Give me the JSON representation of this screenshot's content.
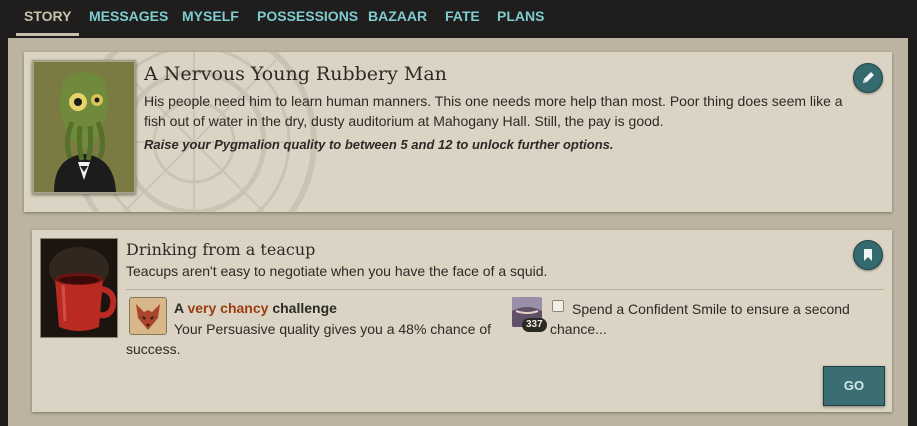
{
  "nav": {
    "tabs": [
      {
        "label": "STORY"
      },
      {
        "label": "MESSAGES"
      },
      {
        "label": "MYSELF"
      },
      {
        "label": "POSSESSIONS"
      },
      {
        "label": "BAZAAR"
      },
      {
        "label": "FATE"
      },
      {
        "label": "PLANS"
      }
    ],
    "active_tab": "STORY"
  },
  "storylet": {
    "title": "A Nervous Young Rubbery Man",
    "description": "His people need him to learn human manners. This one needs more help than most. Poor thing does seem like a fish out of water in the dry, dusty auditorium at Mahogany Hall. Still, the pay is good.",
    "requirement": "Raise your Pygmalion quality to between 5 and 12 to unlock further options.",
    "edit_icon": "pencil-icon"
  },
  "branch": {
    "title": "Drinking from a teacup",
    "description": "Teacups aren't easy to negotiate when you have the face of a squid.",
    "bookmark_icon": "bookmark-icon",
    "challenge": {
      "prefix": "A",
      "chancy": "very chancy",
      "suffix": "challenge",
      "text": "Your Persuasive quality gives you a 48% chance of success.",
      "icon": "wolf-mask-icon"
    },
    "second_chance": {
      "count": "337",
      "text": "Spend a Confident Smile to ensure a second chance...",
      "checked": false
    },
    "go_label": "GO"
  },
  "colors": {
    "accent": "#7ecbd0",
    "button": "#3b6e73",
    "chancy": "#9b3d12",
    "card": "#dbd4c4"
  }
}
